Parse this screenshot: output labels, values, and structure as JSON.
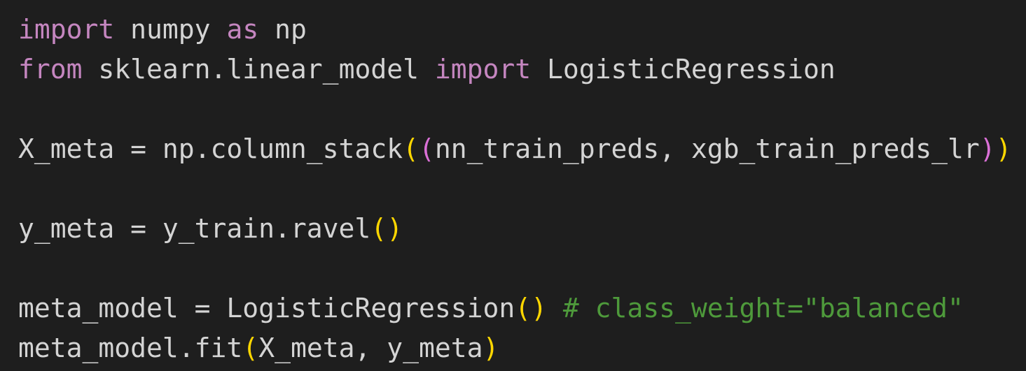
{
  "colors": {
    "background": "#1e1e1e",
    "plain": "#d4d4d4",
    "keyword": "#c586c0",
    "bracket_gold": "#ffd700",
    "bracket_magenta": "#da70d6",
    "comment": "#4e9a3b"
  },
  "code": {
    "lines": [
      {
        "tokens": [
          {
            "text": "import",
            "type": "keyword"
          },
          {
            "text": " numpy ",
            "type": "plain"
          },
          {
            "text": "as",
            "type": "keyword"
          },
          {
            "text": " np",
            "type": "plain"
          }
        ]
      },
      {
        "tokens": [
          {
            "text": "from",
            "type": "keyword"
          },
          {
            "text": " sklearn.linear_model ",
            "type": "plain"
          },
          {
            "text": "import",
            "type": "keyword"
          },
          {
            "text": " LogisticRegression",
            "type": "plain"
          }
        ]
      },
      {
        "tokens": []
      },
      {
        "tokens": [
          {
            "text": "X_meta = np.column_stack",
            "type": "plain"
          },
          {
            "text": "(",
            "type": "bracket_gold"
          },
          {
            "text": "(",
            "type": "bracket_magenta"
          },
          {
            "text": "nn_train_preds, xgb_train_preds_lr",
            "type": "plain"
          },
          {
            "text": ")",
            "type": "bracket_magenta"
          },
          {
            "text": ")",
            "type": "bracket_gold"
          }
        ]
      },
      {
        "tokens": []
      },
      {
        "tokens": [
          {
            "text": "y_meta = y_train.ravel",
            "type": "plain"
          },
          {
            "text": "()",
            "type": "bracket_gold"
          }
        ]
      },
      {
        "tokens": []
      },
      {
        "tokens": [
          {
            "text": "meta_model = LogisticRegression",
            "type": "plain"
          },
          {
            "text": "()",
            "type": "bracket_gold"
          },
          {
            "text": " ",
            "type": "plain"
          },
          {
            "text": "# class_weight=\"balanced\"",
            "type": "comment"
          }
        ]
      },
      {
        "tokens": [
          {
            "text": "meta_model.fit",
            "type": "plain"
          },
          {
            "text": "(",
            "type": "bracket_gold"
          },
          {
            "text": "X_meta, y_meta",
            "type": "plain"
          },
          {
            "text": ")",
            "type": "bracket_gold"
          }
        ]
      }
    ]
  }
}
